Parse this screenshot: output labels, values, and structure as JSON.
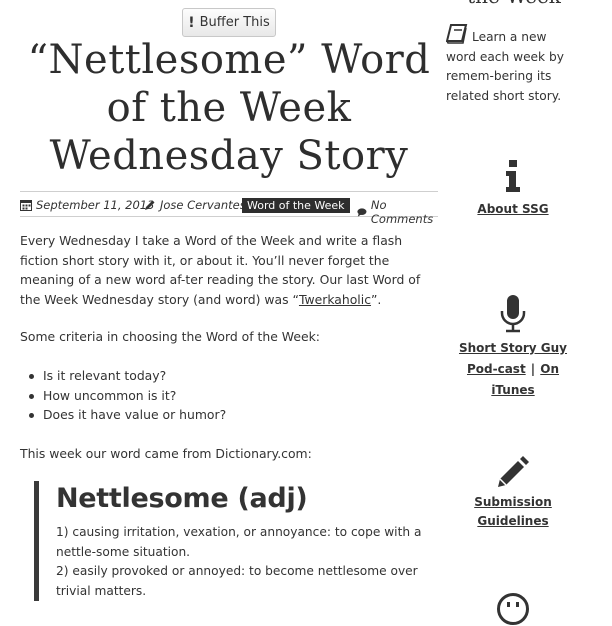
{
  "buffer_button": {
    "label": "Buffer This",
    "icon": "buffer-icon"
  },
  "post": {
    "title_lines": [
      "“Nettlesome” Word",
      "of the Week",
      "Wednesday Story"
    ],
    "meta": {
      "date": "September 11, 2013",
      "author": "Jose Cervantes",
      "category": "Word of the Week",
      "comments": "No Comments"
    },
    "intro": {
      "text_before_link": "Every Wednesday I take a Word of the Week and write a flash fiction short story with it, or about it. You’ll never forget the meaning of a new word af-ter reading the story. Our last Word of the Week Wednesday story (and word) was “",
      "link": "Twerkaholic",
      "text_after_link": "”."
    },
    "criteria_intro": "Some criteria in choosing the Word of the Week:",
    "criteria": [
      "Is it relevant today?",
      "How uncommon is it?",
      "Does it have value or humor?"
    ],
    "source_line": "This week our word came from Dictionary.com:",
    "definition": {
      "heading": "Nettlesome (adj)",
      "lines": [
        "1) causing irritation, vexation, or annoyance: to cope with a nettle-some situation.",
        "2) easily provoked or annoyed: to become nettlesome over trivial matters."
      ]
    }
  },
  "sidebar": {
    "heading_fragment": "the Week",
    "intro": "Learn a new word each week by remem-bering its related short story.",
    "items": [
      {
        "icon": "info-icon",
        "label": "About SSG"
      },
      {
        "icon": "microphone-icon",
        "label": "Short Story Guy Pod-cast",
        "separator": "|",
        "label2": "On iTunes"
      },
      {
        "icon": "pencil-icon",
        "label": "Submission Guidelines"
      },
      {
        "icon": "face-icon"
      }
    ]
  }
}
